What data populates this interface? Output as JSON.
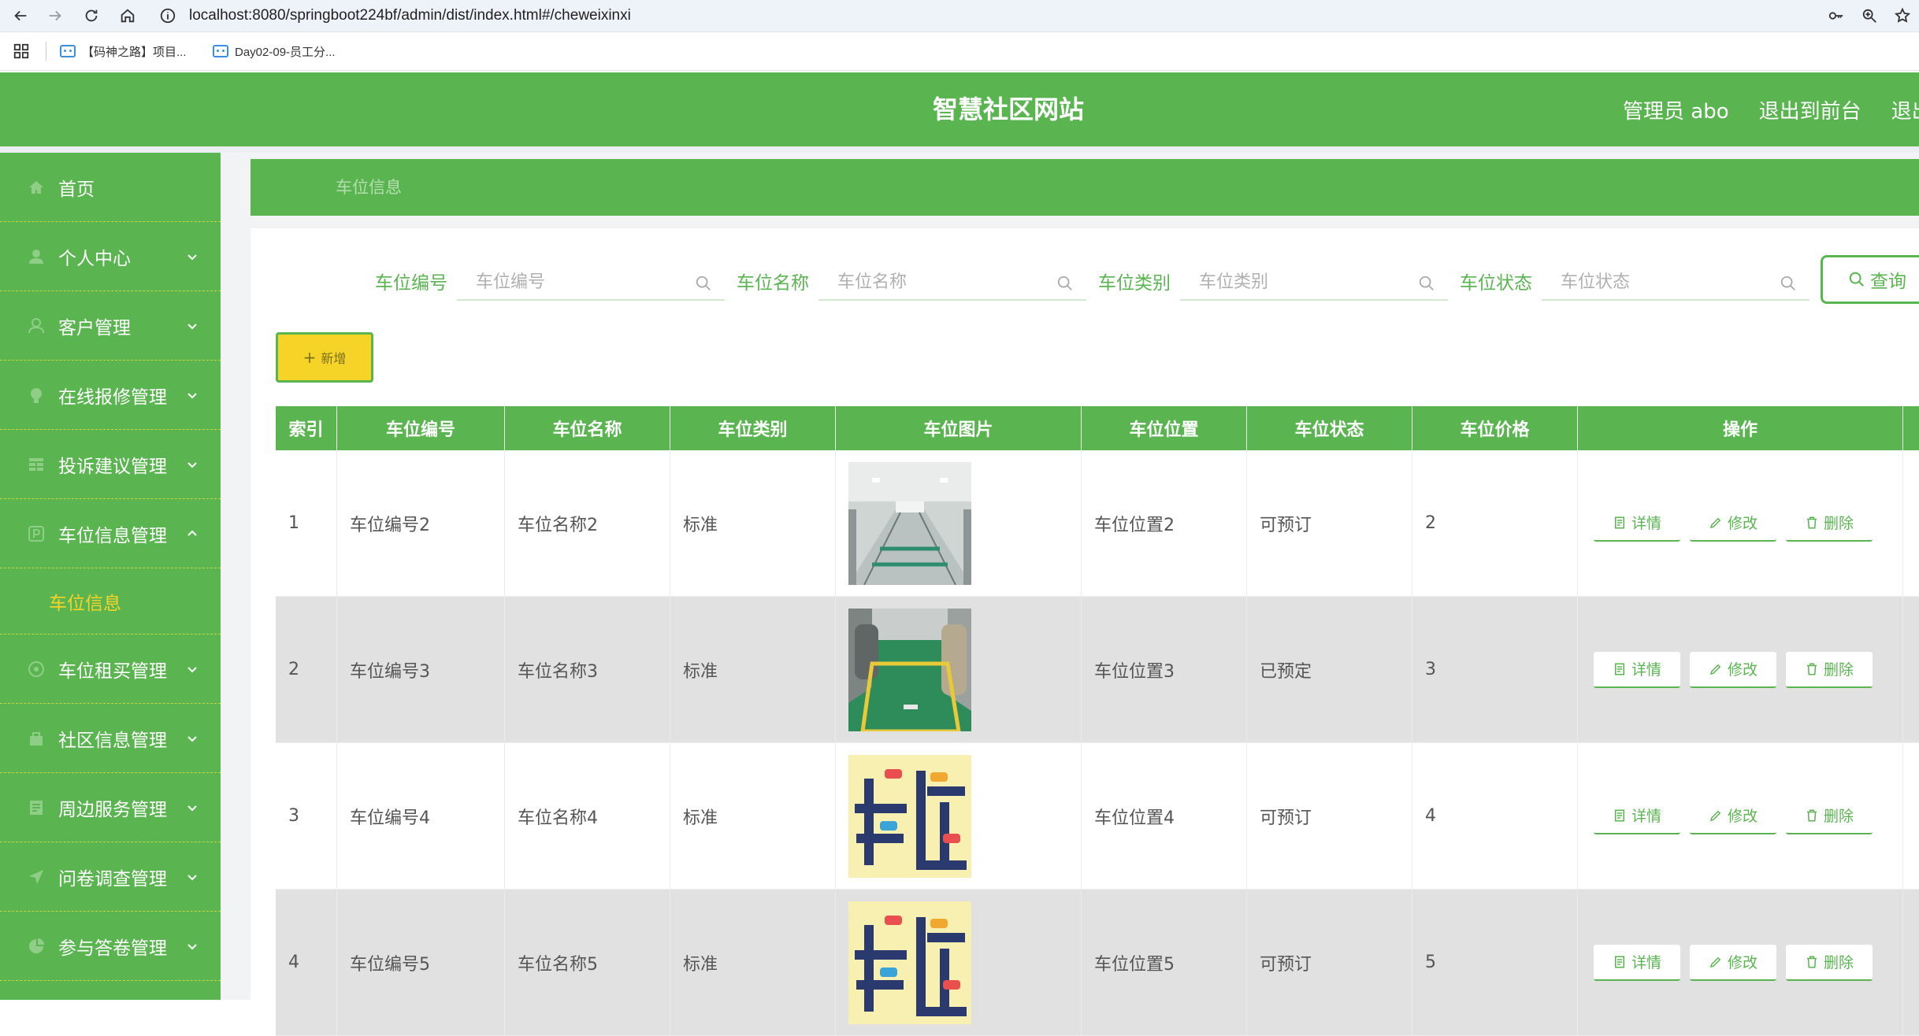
{
  "browser": {
    "url": "localhost:8080/springboot224bf/admin/dist/index.html#/cheweixinxi",
    "bookmarks": [
      "【码神之路】项目...",
      "Day02-09-员工分..."
    ]
  },
  "header": {
    "title": "智慧社区网站",
    "user": "管理员 abo",
    "to_front": "退出到前台",
    "logout": "退出"
  },
  "sidebar": {
    "items": [
      {
        "label": "首页",
        "icon": "home-icon"
      },
      {
        "label": "个人中心",
        "icon": "user-icon"
      },
      {
        "label": "客户管理",
        "icon": "people-icon"
      },
      {
        "label": "在线报修管理",
        "icon": "repair-icon"
      },
      {
        "label": "投诉建议管理",
        "icon": "grid-icon"
      },
      {
        "label": "车位信息管理",
        "icon": "parking-icon"
      },
      {
        "label": "车位租买管理",
        "icon": "car-icon"
      },
      {
        "label": "社区信息管理",
        "icon": "building-icon"
      },
      {
        "label": "周边服务管理",
        "icon": "service-icon"
      },
      {
        "label": "问卷调查管理",
        "icon": "survey-icon"
      },
      {
        "label": "参与答卷管理",
        "icon": "answer-icon"
      }
    ],
    "subitem": "车位信息"
  },
  "breadcrumb": "车位信息",
  "search": {
    "fields": [
      {
        "label": "车位编号",
        "placeholder": "车位编号"
      },
      {
        "label": "车位名称",
        "placeholder": "车位名称"
      },
      {
        "label": "车位类别",
        "placeholder": "车位类别"
      },
      {
        "label": "车位状态",
        "placeholder": "车位状态"
      }
    ],
    "query_label": "查询",
    "add_label": "新增"
  },
  "table": {
    "headers": [
      "索引",
      "车位编号",
      "车位名称",
      "车位类别",
      "车位图片",
      "车位位置",
      "车位状态",
      "车位价格",
      "操作"
    ],
    "rows": [
      {
        "index": "1",
        "code": "车位编号2",
        "name": "车位名称2",
        "type": "标准",
        "image": "garage-photo",
        "location": "车位位置2",
        "status": "可预订",
        "price": "2"
      },
      {
        "index": "2",
        "code": "车位编号3",
        "name": "车位名称3",
        "type": "标准",
        "image": "parking-spot-photo",
        "location": "车位位置3",
        "status": "已预定",
        "price": "3"
      },
      {
        "index": "3",
        "code": "车位编号4",
        "name": "车位名称4",
        "type": "标准",
        "image": "chewei-logo",
        "location": "车位位置4",
        "status": "可预订",
        "price": "4"
      },
      {
        "index": "4",
        "code": "车位编号5",
        "name": "车位名称5",
        "type": "标准",
        "image": "chewei-logo",
        "location": "车位位置5",
        "status": "可预订",
        "price": "5"
      }
    ],
    "actions": {
      "detail": "详情",
      "edit": "修改",
      "delete": "删除"
    }
  },
  "colors": {
    "primary": "#5ab551",
    "accent": "#f5d327",
    "row_alt": "#e1e1e1"
  }
}
